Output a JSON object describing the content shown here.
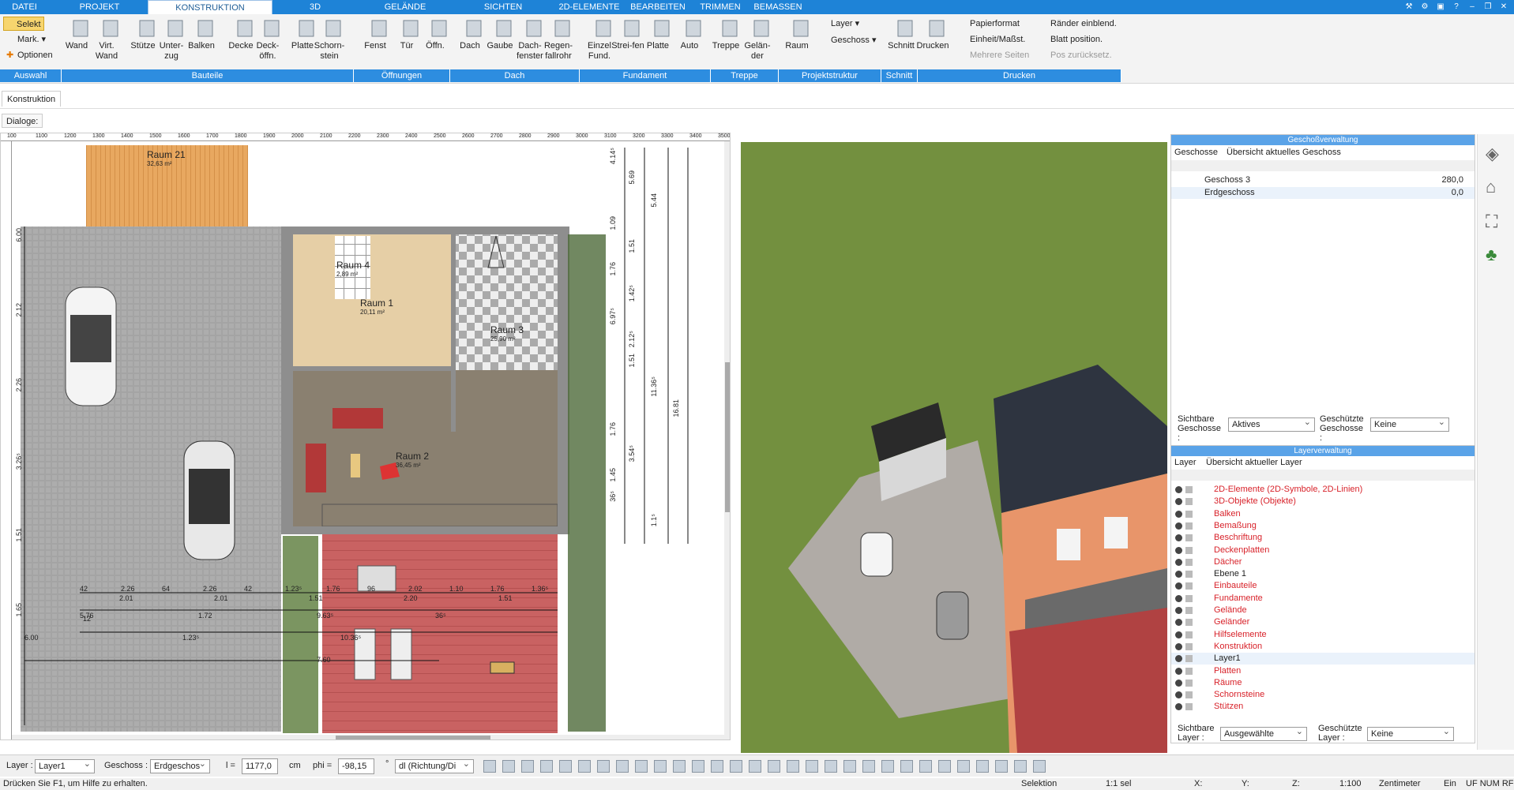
{
  "menu": {
    "tabs": [
      "DATEI",
      "PROJEKT",
      "KONSTRUKTION",
      "3D",
      "GELÄNDE",
      "SICHTEN",
      "2D-ELEMENTE",
      "BEARBEITEN",
      "TRIMMEN",
      "BEMASSEN"
    ],
    "active": "KONSTRUKTION"
  },
  "ribbon": {
    "auswahl": {
      "select": "Selekt",
      "mark": "Mark.",
      "options": "Optionen"
    },
    "buttons": [
      "Wand",
      "Virt. Wand",
      "Stütze",
      "Unter-zug",
      "Balken",
      "Decke",
      "Deck-öffn.",
      "Platte",
      "Schorn-stein",
      "Fenst",
      "Tür",
      "Öffn.",
      "Dach",
      "Gaube",
      "Dach-fenster",
      "Regen-fallrohr",
      "Einzel Fund.",
      "Strei-fen",
      "Platte",
      "Auto",
      "Treppe",
      "Gelän-der",
      "Raum",
      "Schnitt",
      "Drucken"
    ],
    "struct": {
      "layer": "Layer",
      "geschoss": "Geschoss"
    },
    "print_opts": [
      "Papierformat",
      "Einheit/Maßst.",
      "Mehrere Seiten",
      "Ränder einblend.",
      "Blatt position.",
      "Pos zurücksetz."
    ],
    "groups": [
      "Auswahl",
      "Bauteile",
      "Öffnungen",
      "Dach",
      "Fundament",
      "Treppe",
      "Projektstruktur",
      "Schnitt",
      "Drucken"
    ]
  },
  "tab": "Konstruktion",
  "dialoge": "Dialoge:",
  "plan": {
    "rooms": [
      {
        "name": "Raum 21",
        "area": "32,63 m²"
      },
      {
        "name": "Raum 4",
        "area": "2,89 m²"
      },
      {
        "name": "Raum 1",
        "area": "20,11 m²"
      },
      {
        "name": "Raum 3",
        "area": "25,90 m²"
      },
      {
        "name": "Raum 2",
        "area": "36,45 m²"
      }
    ],
    "ruler": [
      "100",
      "1100",
      "1200",
      "1300",
      "1400",
      "1500",
      "1600",
      "1700",
      "1800",
      "1900",
      "2000",
      "2100",
      "2200",
      "2300",
      "2400",
      "2500",
      "2600",
      "2700",
      "2800",
      "2900",
      "3000",
      "3100",
      "3200",
      "3300",
      "3400",
      "3500"
    ],
    "dims_row1": [
      "42",
      "2.26",
      "64",
      "2.26",
      "42",
      "1.23⁵",
      "1.76",
      "96",
      "2.02",
      "1.10",
      "1.76",
      "1.36⁵"
    ],
    "dims_row1b": [
      "2.01",
      "2.01",
      "1.51",
      "2.20",
      "1.51"
    ],
    "dims_row2": [
      "5.76",
      "1.72",
      "9.63⁵",
      "36⁵"
    ],
    "dims_row3": [
      "6.00",
      "1.23⁵",
      "10.36⁵"
    ],
    "dims_misc": [
      "12",
      "7.60"
    ],
    "dims_vert": [
      "4.14⁵",
      "5.69",
      "5.44",
      "1.09",
      "1.51",
      "1.76",
      "1.42⁵",
      "6.97⁵",
      "2.12⁵",
      "1.51",
      "11.36⁵",
      "16.81",
      "1.76",
      "3.54⁵",
      "1.45",
      "36⁵",
      "1.1⁵"
    ],
    "left_dims": [
      "6.00",
      "2.12",
      "2.26",
      "3.26⁵",
      "1.51",
      "1.65"
    ]
  },
  "geschoss": {
    "title": "Geschoßverwaltung",
    "tabs": [
      "Geschosse",
      "Übersicht aktuelles Geschoss"
    ],
    "rows": [
      {
        "name": "Geschoss 3",
        "val": "280,0"
      },
      {
        "name": "Erdgeschoss",
        "val": "0,0"
      }
    ],
    "vis_label": "Sichtbare Geschosse :",
    "vis_value": "Aktives",
    "prot_label": "Geschützte Geschosse :",
    "prot_value": "Keine"
  },
  "layers": {
    "title": "Layerverwaltung",
    "tabs": [
      "Layer",
      "Übersicht aktueller Layer"
    ],
    "items": [
      {
        "n": "2D-Elemente (2D-Symbole, 2D-Linien)",
        "red": true
      },
      {
        "n": "3D-Objekte (Objekte)",
        "red": true
      },
      {
        "n": "Balken",
        "red": true
      },
      {
        "n": "Bemaßung",
        "red": true
      },
      {
        "n": "Beschriftung",
        "red": true
      },
      {
        "n": "Deckenplatten",
        "red": true
      },
      {
        "n": "Dächer",
        "red": true
      },
      {
        "n": "Ebene 1",
        "red": false
      },
      {
        "n": "Einbauteile",
        "red": true
      },
      {
        "n": "Fundamente",
        "red": true
      },
      {
        "n": "Gelände",
        "red": true
      },
      {
        "n": "Geländer",
        "red": true
      },
      {
        "n": "Hilfselemente",
        "red": true
      },
      {
        "n": "Konstruktion",
        "red": true
      },
      {
        "n": "Layer1",
        "red": false
      },
      {
        "n": "Platten",
        "red": true
      },
      {
        "n": "Räume",
        "red": true
      },
      {
        "n": "Schornsteine",
        "red": true
      },
      {
        "n": "Stützen",
        "red": true
      }
    ],
    "vis_label": "Sichtbare Layer :",
    "vis_value": "Ausgewählte",
    "prot_label": "Geschützte Layer :",
    "prot_value": "Keine"
  },
  "status": {
    "layer_label": "Layer :",
    "layer_value": "Layer1",
    "geschoss_label": "Geschoss :",
    "geschoss_value": "Erdgeschos",
    "l_label": "l =",
    "l_value": "1177,0",
    "l_unit": "cm",
    "phi_label": "phi =",
    "phi_value": "-98,15",
    "phi_unit": "°",
    "dl_value": "dl (Richtung/Di"
  },
  "hint": {
    "text": "Drücken Sie F1, um Hilfe zu erhalten.",
    "sel": "Selektion",
    "scale": "1:1 sel",
    "x": "X:",
    "y": "Y:",
    "z": "Z:",
    "ratio": "1:100",
    "unit": "Zentimeter",
    "ein": "Ein",
    "flags": "UF NUM RF"
  },
  "colors": {
    "accent": "#1e83d7",
    "group": "#2d8de0",
    "red_layer": "#d8222a"
  }
}
